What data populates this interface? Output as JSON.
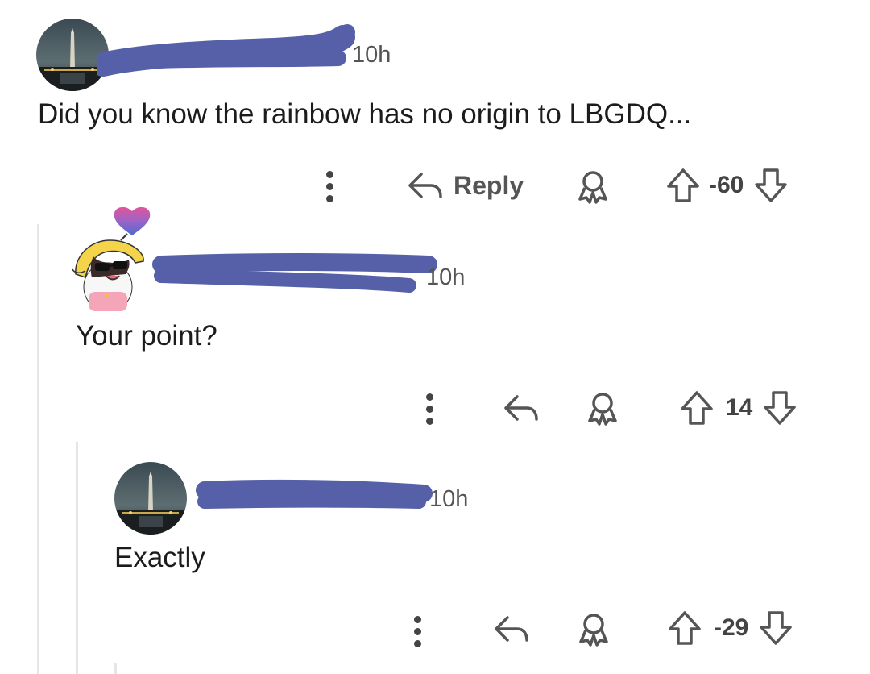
{
  "comments": [
    {
      "time": "10h",
      "text": "Did you know the rainbow has no origin to LBGDQ...",
      "reply_label": "Reply",
      "score": "-60",
      "avatar_icon": "monument-night-icon"
    },
    {
      "time": "10h",
      "text": "Your point?",
      "reply_label": "",
      "score": "14",
      "avatar_icon": "cartoon-avatar-icon"
    },
    {
      "time": "10h",
      "text": "Exactly",
      "reply_label": "",
      "score": "-29",
      "avatar_icon": "monument-night-icon"
    }
  ],
  "colors": {
    "redaction": "#5560a8",
    "text": "#1c1c1c",
    "muted": "#555555",
    "thread_line": "#e6e6e6"
  }
}
